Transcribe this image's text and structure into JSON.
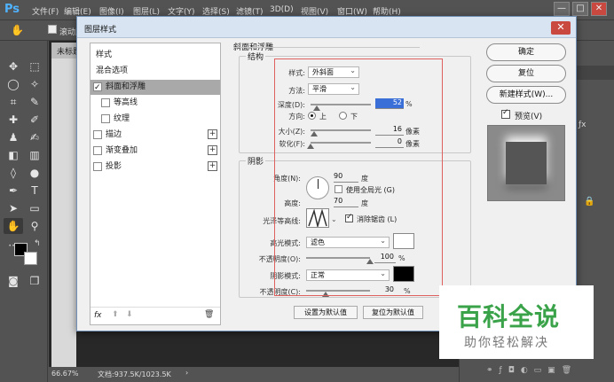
{
  "app": {
    "logo": "Ps",
    "menu": [
      "文件(F)",
      "编辑(E)",
      "图像(I)",
      "图层(L)",
      "文字(Y)",
      "选择(S)",
      "滤镜(T)",
      "3D(D)",
      "视图(V)",
      "窗口(W)",
      "帮助(H)"
    ],
    "win_min": "—",
    "win_max": "□",
    "win_close": "✕"
  },
  "options": {
    "partial": "滚动所"
  },
  "document": {
    "tab": "未标题",
    "zoom": "66.67%",
    "doc_info": "文档:937.5K/1023.5K"
  },
  "dialog": {
    "title": "图层样式",
    "close": "✕",
    "styles": [
      {
        "label": "样式",
        "checkbox": false,
        "checked": false,
        "plus": false,
        "indent": false,
        "active": false
      },
      {
        "label": "混合选项",
        "checkbox": false,
        "checked": false,
        "plus": false,
        "indent": false,
        "active": false
      },
      {
        "label": "斜面和浮雕",
        "checkbox": true,
        "checked": true,
        "plus": false,
        "indent": false,
        "active": true
      },
      {
        "label": "等高线",
        "checkbox": true,
        "checked": false,
        "plus": false,
        "indent": true,
        "active": false
      },
      {
        "label": "纹理",
        "checkbox": true,
        "checked": false,
        "plus": false,
        "indent": true,
        "active": false
      },
      {
        "label": "描边",
        "checkbox": true,
        "checked": false,
        "plus": true,
        "indent": false,
        "active": false
      },
      {
        "label": "渐变叠加",
        "checkbox": true,
        "checked": false,
        "plus": true,
        "indent": false,
        "active": false
      },
      {
        "label": "投影",
        "checkbox": true,
        "checked": false,
        "plus": true,
        "indent": false,
        "active": false
      }
    ],
    "footer_fx": "fx",
    "section_title": "斜面和浮雕",
    "structure": {
      "label": "结构",
      "style_label": "样式:",
      "style_value": "外斜面",
      "technique_label": "方法:",
      "technique_value": "平滑",
      "depth_label": "深度(D):",
      "depth_value": "52",
      "depth_unit": "%",
      "depth_pct": 0.1,
      "direction_label": "方向:",
      "dir_up": "上",
      "dir_down": "下",
      "size_label": "大小(Z):",
      "size_value": "16",
      "size_unit": "像素",
      "size_pct": 0.06,
      "soften_label": "软化(F):",
      "soften_value": "0",
      "soften_unit": "像素",
      "soften_pct": 0.0
    },
    "shading": {
      "label": "阴影",
      "angle_label": "角度(N):",
      "angle_value": "90",
      "angle_unit": "度",
      "global_light_label": "使用全局光 (G)",
      "altitude_label": "高度:",
      "altitude_value": "70",
      "altitude_unit": "度",
      "gloss_label": "光泽等高线:",
      "antialias_label": "消除锯齿 (L)",
      "highlight_mode_label": "高光模式:",
      "highlight_mode_value": "滤色",
      "highlight_opacity_label": "不透明度(O):",
      "highlight_opacity_value": "100",
      "highlight_opacity_unit": "%",
      "highlight_opacity_pct": 1.0,
      "shadow_mode_label": "阴影模式:",
      "shadow_mode_value": "正常",
      "shadow_opacity_label": "不透明度(C):",
      "shadow_opacity_value": "30",
      "shadow_opacity_unit": "%",
      "shadow_opacity_pct": 0.3,
      "highlight_color": "#ffffff",
      "shadow_color": "#000000"
    },
    "make_default": "设置为默认值",
    "reset_default": "复位为默认值",
    "ok": "确定",
    "reset": "复位",
    "new_style": "新建样式(W)...",
    "preview": "预览(V)"
  },
  "watermark": {
    "title": "百科全说",
    "subtitle": "助你轻松解决",
    "color": "#3aa34a"
  }
}
